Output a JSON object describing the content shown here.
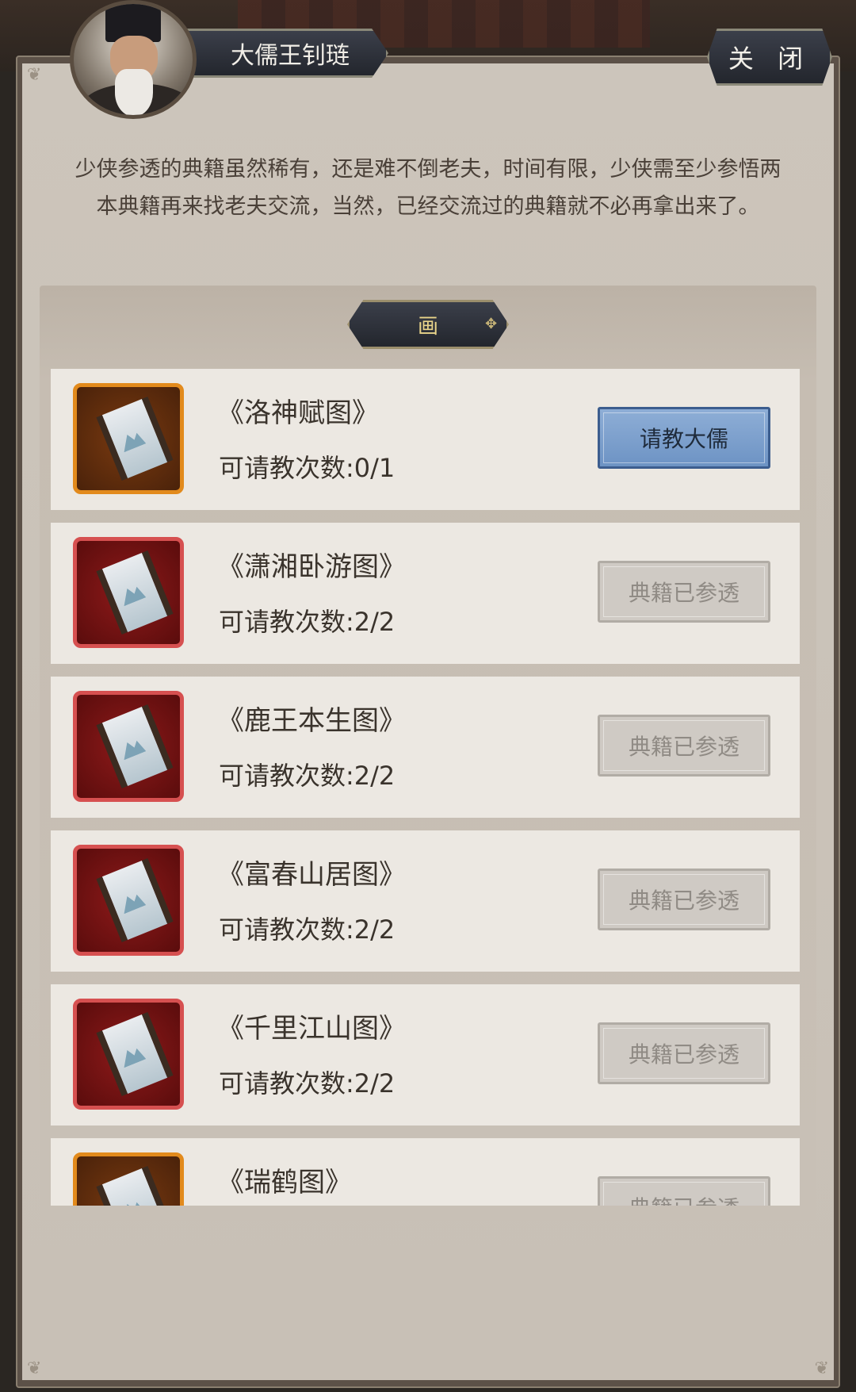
{
  "header": {
    "npc_name": "大儒王钊琏",
    "close_label": "关 闭"
  },
  "description": "少侠参透的典籍虽然稀有，还是难不倒老夫，时间有限，少侠需至少参悟两本典籍再来找老夫交流，当然，已经交流过的典籍就不必再拿出来了。",
  "category": {
    "label": "画"
  },
  "items": [
    {
      "title": "《洛神赋图》",
      "count": "可请教次数:0/1",
      "button": "请教大儒",
      "state": "active",
      "frame": "orange"
    },
    {
      "title": "《潇湘卧游图》",
      "count": "可请教次数:2/2",
      "button": "典籍已参透",
      "state": "done",
      "frame": "red"
    },
    {
      "title": "《鹿王本生图》",
      "count": "可请教次数:2/2",
      "button": "典籍已参透",
      "state": "done",
      "frame": "red"
    },
    {
      "title": "《富春山居图》",
      "count": "可请教次数:2/2",
      "button": "典籍已参透",
      "state": "done",
      "frame": "red"
    },
    {
      "title": "《千里江山图》",
      "count": "可请教次数:2/2",
      "button": "典籍已参透",
      "state": "done",
      "frame": "red"
    },
    {
      "title": "《瑞鹤图》",
      "count": "",
      "button": "典籍已参透",
      "state": "done",
      "frame": "orange"
    }
  ],
  "colors": {
    "active_button": "#7fa2cf",
    "orange_frame": "#e28a1c",
    "red_frame": "#d65050"
  }
}
